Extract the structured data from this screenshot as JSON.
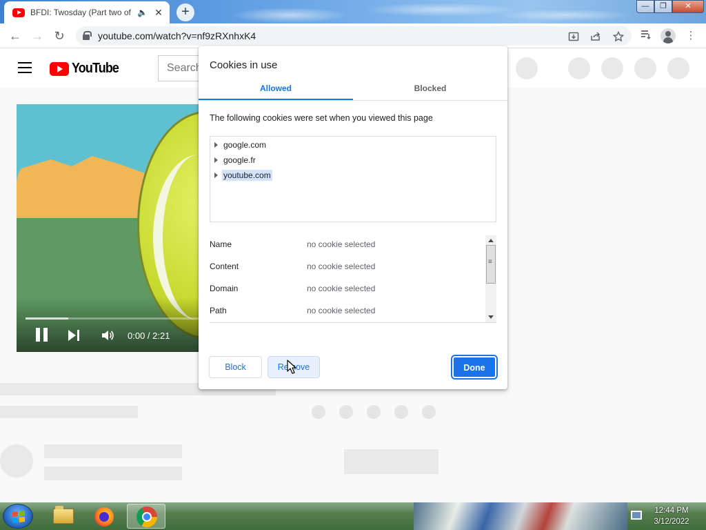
{
  "browser": {
    "tab": {
      "title": "BFDI: Twosday (Part two of T",
      "audio_icon": "🔈",
      "close_icon": "✕"
    },
    "new_tab_icon": "+",
    "window_controls": {
      "minimize": "—",
      "maximize": "❐",
      "close": "✕"
    },
    "nav": {
      "back": "←",
      "forward": "→",
      "reload": "↻"
    },
    "url": "youtube.com/watch?v=nf9zRXnhxK4",
    "omnibox_icons": [
      "install-icon",
      "share-icon",
      "bookmark-star-icon"
    ],
    "toolbar_icons": [
      "reading-list-icon",
      "profile-icon",
      "more-menu-icon"
    ],
    "menu_glyph": "⋮"
  },
  "youtube": {
    "logo_text": "YouTube",
    "search_placeholder": "Search",
    "video": {
      "time": "0:00 / 2:21",
      "played_fraction": 0.24
    }
  },
  "dialog": {
    "title": "Cookies in use",
    "tabs": [
      {
        "label": "Allowed",
        "active": true
      },
      {
        "label": "Blocked",
        "active": false
      }
    ],
    "description": "The following cookies were set when you viewed this page",
    "domains": [
      {
        "label": "google.com",
        "selected": false
      },
      {
        "label": "google.fr",
        "selected": false
      },
      {
        "label": "youtube.com",
        "selected": true
      }
    ],
    "details": [
      {
        "key": "Name",
        "value": "no cookie selected"
      },
      {
        "key": "Content",
        "value": "no cookie selected"
      },
      {
        "key": "Domain",
        "value": "no cookie selected"
      },
      {
        "key": "Path",
        "value": "no cookie selected"
      }
    ],
    "buttons": {
      "block": "Block",
      "remove": "Remove",
      "done": "Done"
    }
  },
  "taskbar": {
    "apps": [
      "windows-explorer",
      "firefox",
      "chrome"
    ],
    "active_app": "chrome",
    "clock": {
      "time": "12:44 PM",
      "date": "3/12/2022"
    }
  },
  "colors": {
    "accent": "#1a73e8",
    "youtube_red": "#ff0000",
    "selection": "#d3e3fd"
  }
}
